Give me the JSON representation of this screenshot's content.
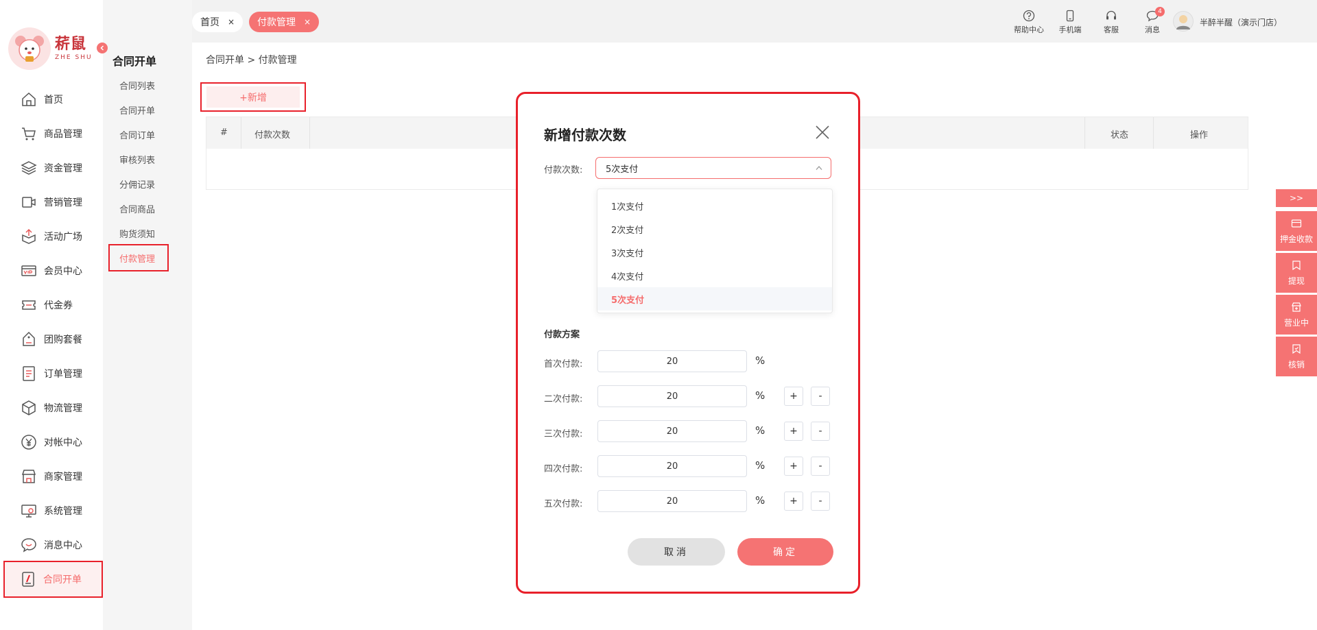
{
  "brand": {
    "name_cn": "菥鼠",
    "name_en": "ZHE SHU",
    "accent": "#f56c6c",
    "highlight_border": "#e8202a"
  },
  "sidebar": {
    "items": [
      {
        "label": "首页",
        "icon": "home-icon"
      },
      {
        "label": "商品管理",
        "icon": "cart-icon"
      },
      {
        "label": "资金管理",
        "icon": "layers-icon"
      },
      {
        "label": "营销管理",
        "icon": "marketing-icon"
      },
      {
        "label": "活动广场",
        "icon": "box-upload-icon"
      },
      {
        "label": "会员中心",
        "icon": "vip-icon"
      },
      {
        "label": "代金券",
        "icon": "ticket-icon"
      },
      {
        "label": "团购套餐",
        "icon": "tag-icon"
      },
      {
        "label": "订单管理",
        "icon": "list-icon"
      },
      {
        "label": "物流管理",
        "icon": "package-icon"
      },
      {
        "label": "对帐中心",
        "icon": "yen-icon"
      },
      {
        "label": "商家管理",
        "icon": "store-icon"
      },
      {
        "label": "系统管理",
        "icon": "monitor-gear-icon"
      },
      {
        "label": "消息中心",
        "icon": "chat-icon"
      },
      {
        "label": "合同开单",
        "icon": "contract-icon",
        "active": true
      }
    ]
  },
  "subbar": {
    "title": "合同开单",
    "items": [
      {
        "label": "合同列表"
      },
      {
        "label": "合同开单"
      },
      {
        "label": "合同订单"
      },
      {
        "label": "审核列表"
      },
      {
        "label": "分佣记录"
      },
      {
        "label": "合同商品"
      },
      {
        "label": "购货须知"
      },
      {
        "label": "付款管理",
        "active": true
      }
    ]
  },
  "tabs": [
    {
      "label": "首页",
      "close": "×"
    },
    {
      "label": "付款管理",
      "close": "×",
      "active": true
    }
  ],
  "top_tools": {
    "help": "帮助中心",
    "mobile": "手机端",
    "service": "客服",
    "messages": "消息",
    "message_count": "4",
    "user_name": "半醉半醒（演示门店）"
  },
  "content": {
    "breadcrumb": "合同开单 > 付款管理",
    "add_button": "+新增",
    "table_headers": {
      "index": "#",
      "times": "付款次数",
      "status": "状态",
      "actions": "操作"
    }
  },
  "float_panel": {
    "toggle": ">>",
    "items": [
      {
        "label": "押金收款",
        "icon": "card-icon"
      },
      {
        "label": "提现",
        "icon": "bookmark-icon"
      },
      {
        "label": "营业中",
        "icon": "shop-icon"
      },
      {
        "label": "核销",
        "icon": "bookmark-check-icon"
      }
    ]
  },
  "modal": {
    "title": "新增付款次数",
    "close_icon": "close-icon",
    "times_label": "付款次数:",
    "times_value": "5次支付",
    "options": [
      "1次支付",
      "2次支付",
      "3次支付",
      "4次支付",
      "5次支付"
    ],
    "selected_option": "5次支付",
    "plan_title": "付款方案",
    "payments": [
      {
        "label": "首次付款:",
        "value": "20"
      },
      {
        "label": "二次付款:",
        "value": "20"
      },
      {
        "label": "三次付款:",
        "value": "20"
      },
      {
        "label": "四次付款:",
        "value": "20"
      },
      {
        "label": "五次付款:",
        "value": "20"
      }
    ],
    "percent_sign": "%",
    "plus": "+",
    "minus": "-",
    "cancel": "取消",
    "confirm": "确定"
  }
}
